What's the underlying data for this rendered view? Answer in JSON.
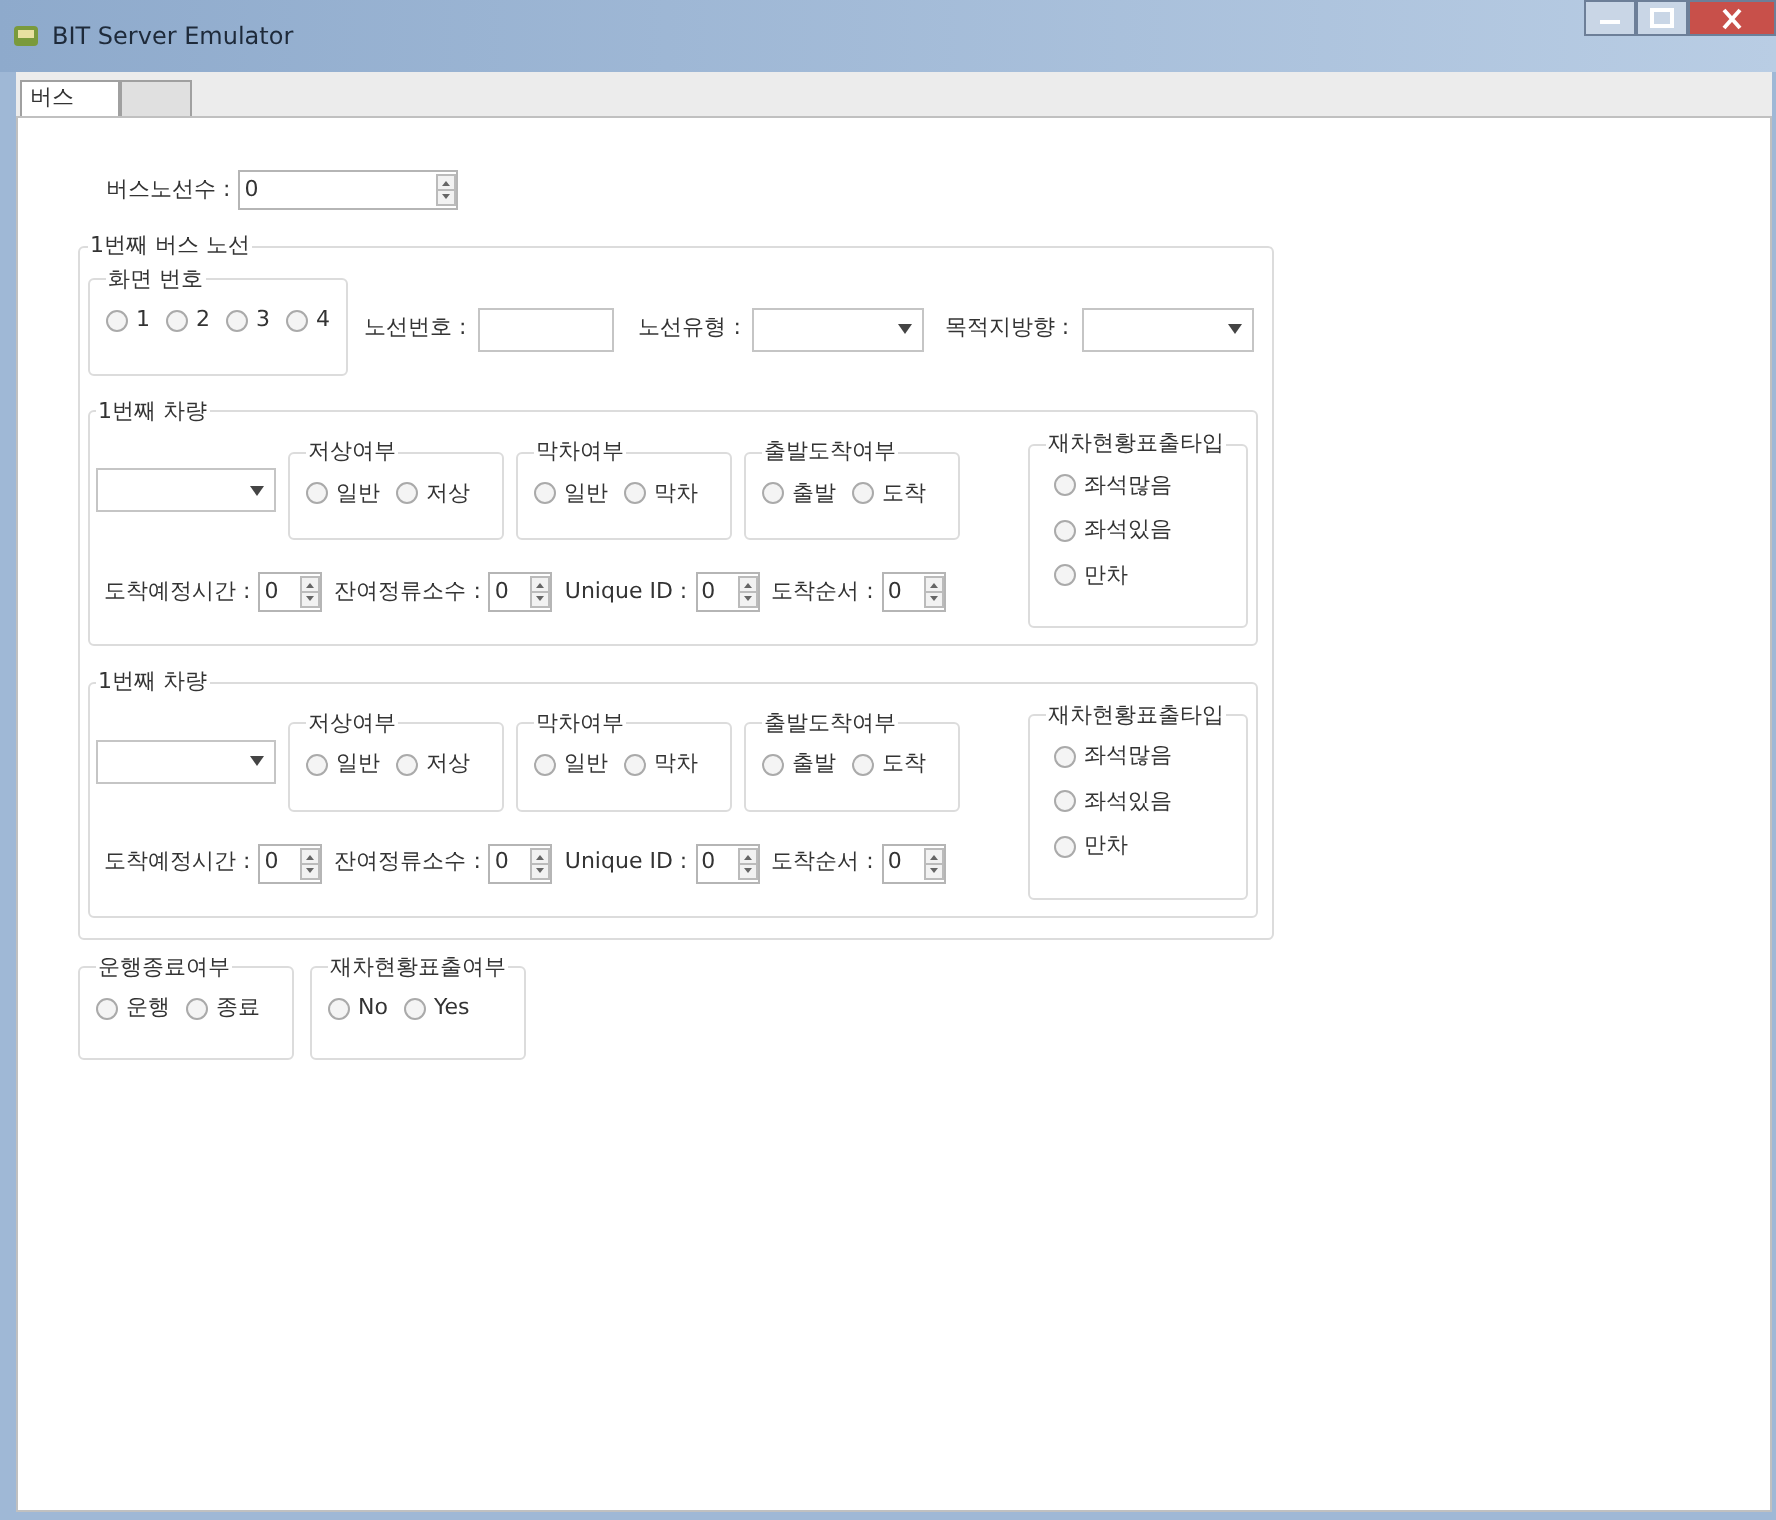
{
  "window": {
    "title": "BIT Server  Emulator"
  },
  "tabs": [
    {
      "label": "버스",
      "selected": true
    },
    {
      "selected": false
    }
  ],
  "route_count": {
    "label": "버스노선수 :",
    "value": "0"
  },
  "route_group": {
    "title": "1번째 버스 노선",
    "screen_number": {
      "title": "화면 번호",
      "options": [
        {
          "label": "1",
          "selected": false
        },
        {
          "label": "2",
          "selected": false
        },
        {
          "label": "3",
          "selected": false
        },
        {
          "label": "4",
          "selected": false
        }
      ]
    },
    "route_number": {
      "label": "노선번호 :"
    },
    "route_type": {
      "label": "노선유형 :"
    },
    "destination": {
      "label": "목적지방향 :"
    },
    "vehicles": [
      {
        "title": "1번째 차량",
        "groups": [
          {
            "title": "저상여부",
            "options": [
              {
                "label": "일반",
                "selected": false
              },
              {
                "label": "저상",
                "selected": false
              }
            ]
          },
          {
            "title": "막차여부",
            "options": [
              {
                "label": "일반",
                "selected": false
              },
              {
                "label": "막차",
                "selected": false
              }
            ]
          },
          {
            "title": "출발도착여부",
            "options": [
              {
                "label": "출발",
                "selected": false
              },
              {
                "label": "도착",
                "selected": false
              }
            ]
          }
        ],
        "crowd": {
          "title": "재차현황표출타입",
          "options": [
            {
              "label": "좌석많음",
              "selected": false
            },
            {
              "label": "좌석있음",
              "selected": false
            },
            {
              "label": "만차",
              "selected": false
            }
          ]
        },
        "fields": [
          {
            "label": "도착예정시간 :",
            "value": "0"
          },
          {
            "label": "잔여정류소수 :",
            "value": "0"
          },
          {
            "label": "Unique ID :",
            "value": "0"
          },
          {
            "label": "도착순서 :",
            "value": "0"
          }
        ]
      },
      {
        "title": "1번째 차량",
        "groups": [
          {
            "title": "저상여부",
            "options": [
              {
                "label": "일반",
                "selected": false
              },
              {
                "label": "저상",
                "selected": false
              }
            ]
          },
          {
            "title": "막차여부",
            "options": [
              {
                "label": "일반",
                "selected": false
              },
              {
                "label": "막차",
                "selected": false
              }
            ]
          },
          {
            "title": "출발도착여부",
            "options": [
              {
                "label": "출발",
                "selected": false
              },
              {
                "label": "도착",
                "selected": false
              }
            ]
          }
        ],
        "crowd": {
          "title": "재차현황표출타입",
          "options": [
            {
              "label": "좌석많음",
              "selected": false
            },
            {
              "label": "좌석있음",
              "selected": false
            },
            {
              "label": "만차",
              "selected": false
            }
          ]
        },
        "fields": [
          {
            "label": "도착예정시간 :",
            "value": "0"
          },
          {
            "label": "잔여정류소수 :",
            "value": "0"
          },
          {
            "label": "Unique ID :",
            "value": "0"
          },
          {
            "label": "도착순서 :",
            "value": "0"
          }
        ]
      }
    ]
  },
  "bottom_groups": [
    {
      "title": "운행종료여부",
      "options": [
        {
          "label": "운행",
          "selected": false
        },
        {
          "label": "종료",
          "selected": false
        }
      ]
    },
    {
      "title": "재차현황표출여부",
      "options": [
        {
          "label": "No",
          "selected": false
        },
        {
          "label": "Yes",
          "selected": false
        }
      ]
    }
  ]
}
